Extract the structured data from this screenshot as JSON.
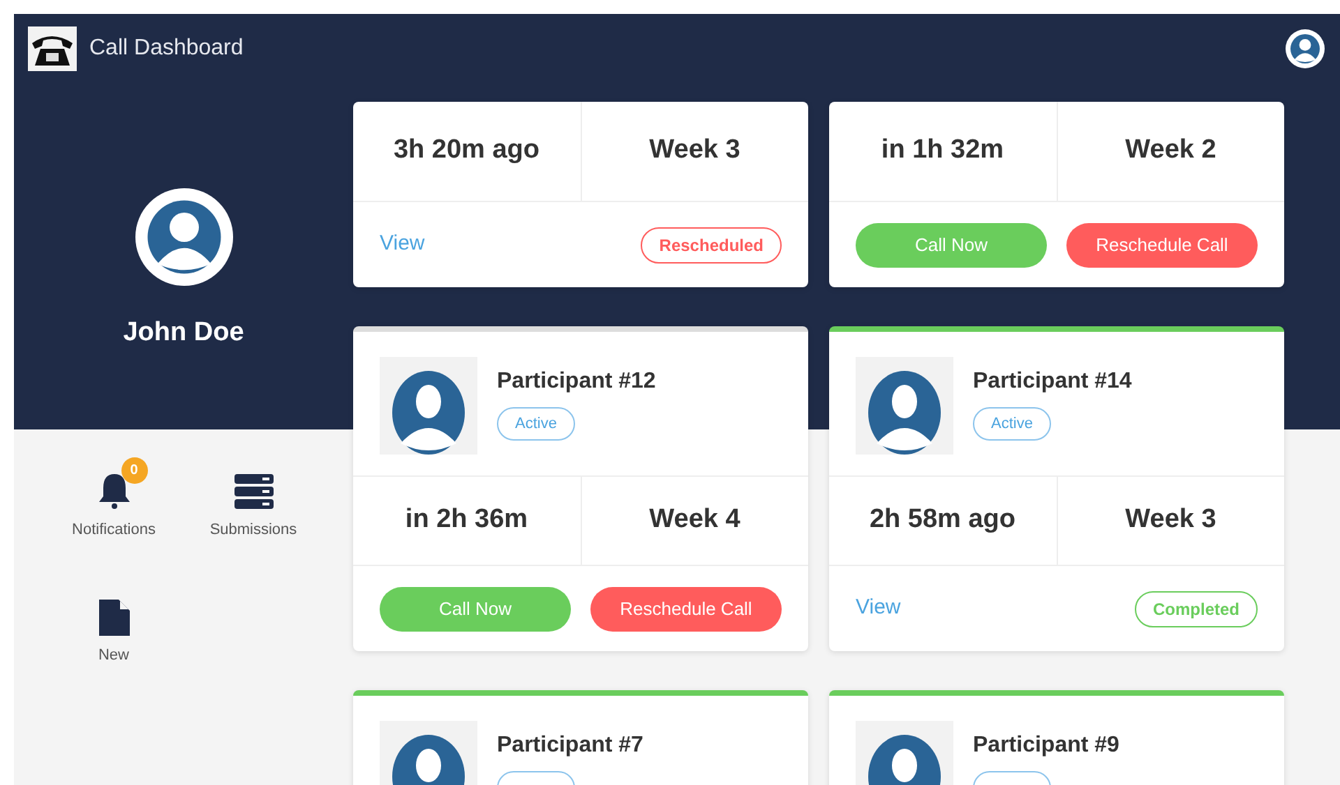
{
  "header": {
    "title": "Call Dashboard"
  },
  "profile": {
    "name": "John Doe"
  },
  "nav": [
    {
      "label": "Notifications",
      "kind": "bell",
      "badge": "0"
    },
    {
      "label": "Submissions",
      "kind": "stack"
    },
    {
      "label": "New",
      "kind": "file"
    }
  ],
  "cards": [
    {
      "metrics": [
        "3h 20m ago",
        "Week 3"
      ],
      "actions": [
        {
          "kind": "link",
          "label": "View"
        },
        {
          "kind": "status",
          "label": "Rescheduled",
          "color": "#ff5c5c"
        }
      ]
    },
    {
      "metrics": [
        "in 1h 32m",
        "Week 2"
      ],
      "actions": [
        {
          "kind": "call",
          "label": "Call Now"
        },
        {
          "kind": "reschedule",
          "label": "Reschedule Call"
        }
      ]
    },
    {
      "color": "#dddddd",
      "participant": {
        "name": "Participant #12",
        "status": "Active"
      },
      "metrics": [
        "in 2h 36m",
        "Week 4"
      ],
      "actions": [
        {
          "kind": "call",
          "label": "Call Now"
        },
        {
          "kind": "reschedule",
          "label": "Reschedule Call"
        }
      ]
    },
    {
      "color": "#6acd5c",
      "participant": {
        "name": "Participant #14",
        "status": "Active"
      },
      "metrics": [
        "2h 58m ago",
        "Week 3"
      ],
      "actions": [
        {
          "kind": "link",
          "label": "View"
        },
        {
          "kind": "status",
          "label": "Completed",
          "color": "#6acd5c"
        }
      ]
    },
    {
      "color": "#6acd5c",
      "participant": {
        "name": "Participant #7"
      }
    },
    {
      "color": "#6acd5c",
      "participant": {
        "name": "Participant #9"
      }
    }
  ]
}
